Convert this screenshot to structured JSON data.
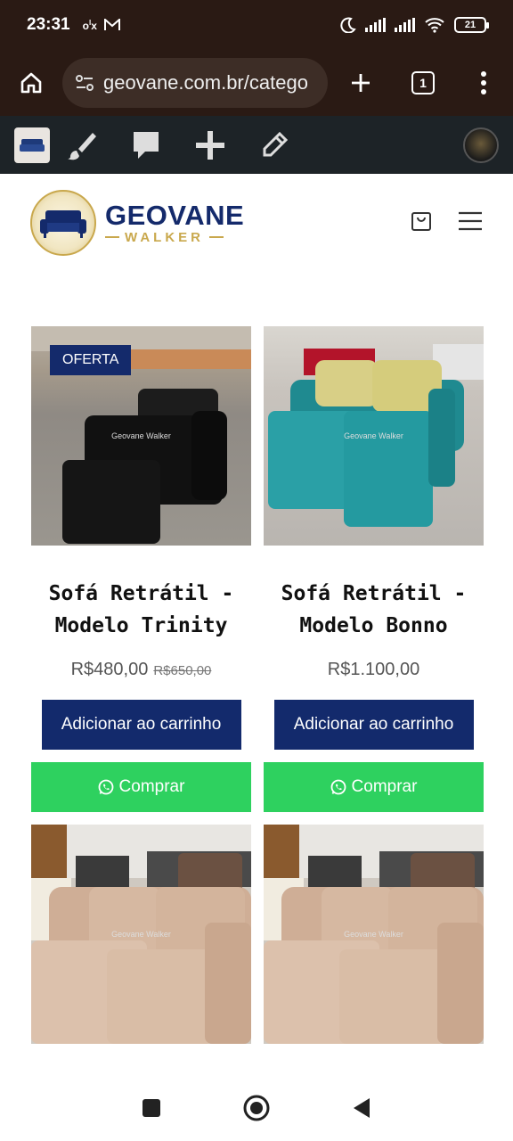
{
  "status_bar": {
    "time": "23:31",
    "left_icons": [
      "olx-icon",
      "gmail-icon"
    ],
    "battery": "21"
  },
  "browser": {
    "url": "geovane.com.br/catego",
    "tab_count": "1"
  },
  "admin_bar": {
    "icons": [
      "site-thumbnail",
      "customize-brush-icon",
      "comments-icon",
      "add-new-icon",
      "edit-pencil-icon",
      "user-avatar"
    ]
  },
  "site": {
    "logo_name": "GEOVANE",
    "logo_sub": "WALKER",
    "colors": {
      "brand_blue": "#142a6b",
      "brand_gold": "#c9a84d",
      "whatsapp_green": "#2ed15f"
    }
  },
  "products": [
    {
      "badge": "OFERTA",
      "watermark": "Geovane Walker",
      "title_line1": "Sofá Retrátil -",
      "title_line2": "Modelo Trinity",
      "price": "R$480,00",
      "old_price": "R$650,00",
      "add_label": "Adicionar ao carrinho",
      "buy_label": "Comprar"
    },
    {
      "badge": "",
      "watermark": "Geovane Walker",
      "title_line1": "Sofá Retrátil -",
      "title_line2": "Modelo Bonno",
      "price": "R$1.100,00",
      "old_price": "",
      "add_label": "Adicionar ao carrinho",
      "buy_label": "Comprar"
    },
    {
      "watermark": "Geovane Walker"
    },
    {
      "watermark": "Geovane Walker"
    }
  ]
}
